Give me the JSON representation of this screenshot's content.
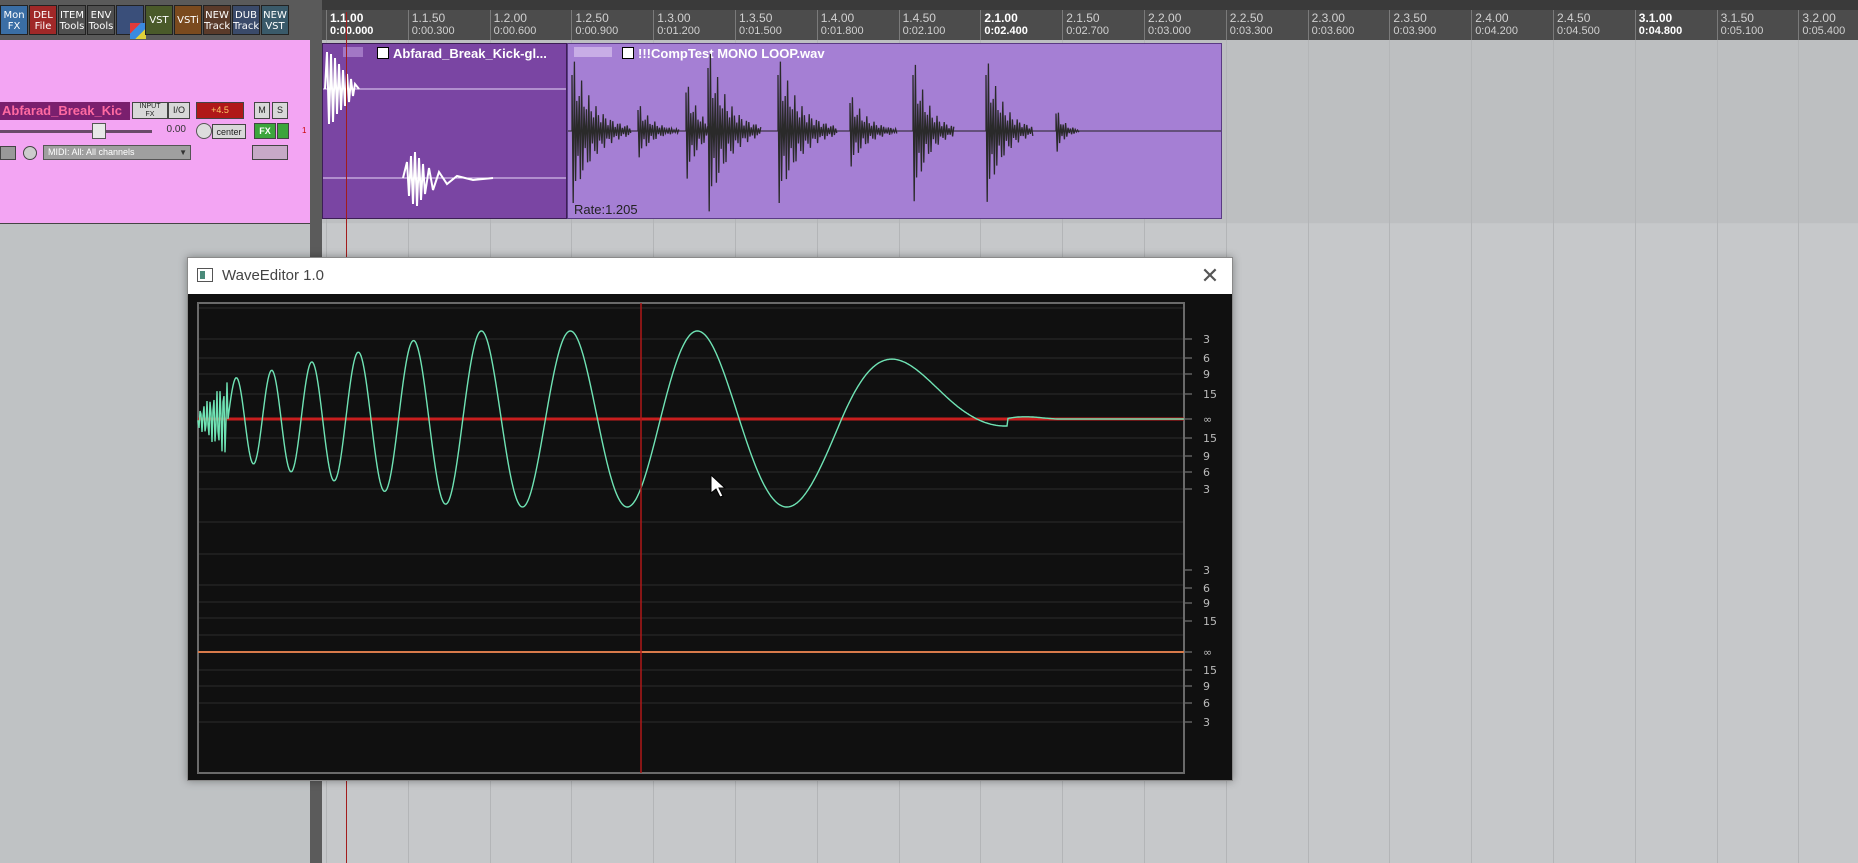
{
  "toolbar": {
    "buttons": [
      {
        "label": "Mon\nFX",
        "color": "#3a6ea5"
      },
      {
        "label": "DEL\nFile",
        "color": "#a02828"
      },
      {
        "label": "ITEM\nTools",
        "color": "#4f4f4f"
      },
      {
        "label": "ENV\nTools",
        "color": "#4f4f4f"
      },
      {
        "label": "",
        "color": "#3a4f7a",
        "icon": "color-palette-icon"
      },
      {
        "label": "VST",
        "color": "#4a5a2a"
      },
      {
        "label": "VSTi",
        "color": "#7a4a1e"
      },
      {
        "label": "NEW\nTrack",
        "color": "#5a3a2a"
      },
      {
        "label": "DUB\nTrack",
        "color": "#3a4a6a"
      },
      {
        "label": "NEW\nVST",
        "color": "#3a5a6a"
      }
    ]
  },
  "ruler": {
    "marks": [
      {
        "bar": "1.1.00",
        "time": "0:00.000",
        "major": true
      },
      {
        "bar": "1.1.50",
        "time": "0:00.300"
      },
      {
        "bar": "1.2.00",
        "time": "0:00.600"
      },
      {
        "bar": "1.2.50",
        "time": "0:00.900"
      },
      {
        "bar": "1.3.00",
        "time": "0:01.200"
      },
      {
        "bar": "1.3.50",
        "time": "0:01.500"
      },
      {
        "bar": "1.4.00",
        "time": "0:01.800"
      },
      {
        "bar": "1.4.50",
        "time": "0:02.100"
      },
      {
        "bar": "2.1.00",
        "time": "0:02.400",
        "major": true
      },
      {
        "bar": "2.1.50",
        "time": "0:02.700"
      },
      {
        "bar": "2.2.00",
        "time": "0:03.000"
      },
      {
        "bar": "2.2.50",
        "time": "0:03.300"
      },
      {
        "bar": "2.3.00",
        "time": "0:03.600"
      },
      {
        "bar": "2.3.50",
        "time": "0:03.900"
      },
      {
        "bar": "2.4.00",
        "time": "0:04.200"
      },
      {
        "bar": "2.4.50",
        "time": "0:04.500"
      },
      {
        "bar": "3.1.00",
        "time": "0:04.800",
        "major": true
      },
      {
        "bar": "3.1.50",
        "time": "0:05.100"
      },
      {
        "bar": "3.2.00",
        "time": "0:05.400"
      }
    ]
  },
  "track": {
    "name": "Abfarad_Break_Kic",
    "input_fx": "INPUT\nFX",
    "io": "I/O",
    "meter_db": "+4.5",
    "mute": "M",
    "solo": "S",
    "volume": "0.00",
    "pan": "center",
    "fx": "FX",
    "midi_input": "MIDI: All: All channels",
    "number": "1"
  },
  "items": [
    {
      "name": "Abfarad_Break_Kick-gl...",
      "color": "#7a45a3"
    },
    {
      "name": "!!!CompTest MONO LOOP.wav",
      "color": "#a57fd4",
      "rate": "Rate:1.205"
    }
  ],
  "wave_editor": {
    "title": "WaveEditor 1.0",
    "close": "✕",
    "scale_labels": [
      "3",
      "6",
      "9",
      "15",
      "∞",
      "15",
      "9",
      "6",
      "3"
    ],
    "wave_color": "#6fe3b4",
    "center_line_color": "#c81e1e",
    "lower_line_color": "#d87a4a",
    "grid_color": "#2b2b2b",
    "cursor_color": "#b01818"
  }
}
